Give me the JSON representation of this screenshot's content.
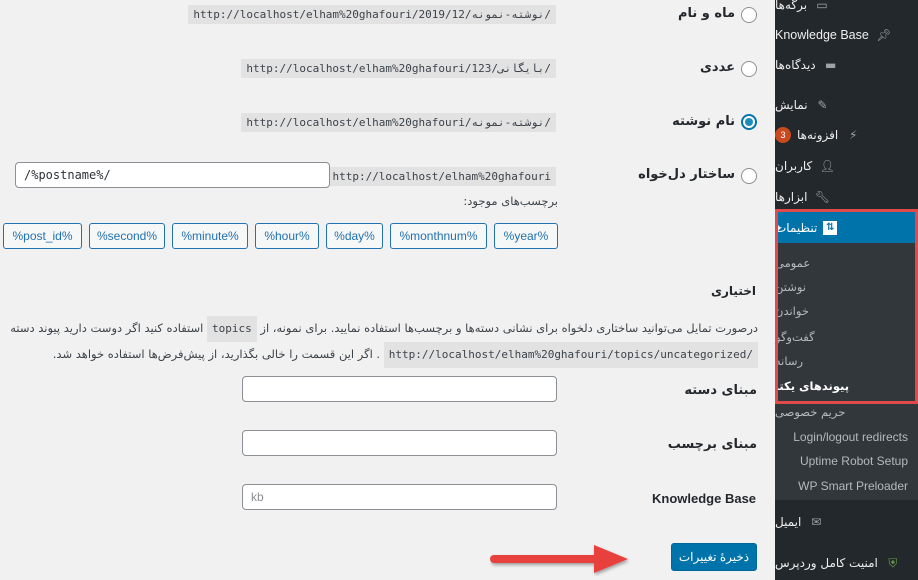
{
  "sidebar": {
    "items": [
      {
        "label": "برگه‌ها",
        "icon": "pages-icon"
      },
      {
        "label": "Knowledge Base",
        "icon": "pin-icon"
      },
      {
        "label": "دیدگاه‌ها",
        "icon": "comment-icon"
      },
      {
        "label": "نمایش",
        "icon": "brush-icon"
      },
      {
        "label": "افزونه‌ها",
        "icon": "plugin-icon",
        "badge": "3"
      },
      {
        "label": "کاربران",
        "icon": "user-icon"
      },
      {
        "label": "ابزارها",
        "icon": "wrench-icon"
      },
      {
        "label": "تنظیمات",
        "icon": "settings-icon"
      }
    ],
    "submenu": [
      "عمومی",
      "نوشتن",
      "خواندن",
      "گفت‌وگو",
      "رسانه",
      "پیوندهای یکتا",
      "حریم خصوصی",
      "Login/logout redirects",
      "Uptime Robot Setup",
      "WP Smart Preloader"
    ],
    "bottom_items": [
      {
        "label": "ایمیل",
        "icon": "mail-icon"
      },
      {
        "label": "امنیت کامل وردپرس",
        "icon": "shield-icon"
      }
    ]
  },
  "permalink_options": [
    {
      "label": "ماه و نام",
      "example": "http://localhost/elham%20ghafouri/2019/12/نوشته-نمونه/",
      "checked": false
    },
    {
      "label": "عددی",
      "example": "http://localhost/elham%20ghafouri/123/بایگانی/",
      "checked": false
    },
    {
      "label": "نام نوشته",
      "example": "http://localhost/elham%20ghafouri/نوشته-نمونه/",
      "checked": true
    },
    {
      "label": "ساختار دل‌خواه",
      "example": "http://localhost/elham%20ghafouri",
      "checked": false,
      "value": "/%postname%/"
    }
  ],
  "available_tags_label": "برچسب‌های موجود:",
  "tags": [
    "%year%",
    "%monthnum%",
    "%day%",
    "%hour%",
    "%minute%",
    "%second%",
    "%post_id%"
  ],
  "optional": {
    "title": "اختیاری",
    "desc_line1_a": "درصورت تمایل می‌توانید ساختاری دلخواه برای نشانی دسته‌ها و برچسب‌ها استفاده نمایید. برای نمونه، از",
    "desc_code1": "topics",
    "desc_line1_b": "استفاده کنید اگر دوست دارید پیوند دسته",
    "desc_code2": "http://localhost/elham%20ghafouri/topics/uncategorized/",
    "desc_line2_b": ". اگر این قسمت را خالی بگذارید، از پیش‌فرض‌ها استفاده خواهد شد."
  },
  "fields": [
    {
      "label": "مبنای دسته",
      "value": "",
      "placeholder": ""
    },
    {
      "label": "مبنای برچسب",
      "value": "",
      "placeholder": ""
    },
    {
      "label": "Knowledge Base",
      "value": "",
      "placeholder": "kb"
    }
  ],
  "save_label": "ذخیرهٔ تغییرات",
  "colors": {
    "accent": "#0073aa",
    "highlight": "#e04a4a",
    "badge": "#ca4a1f"
  }
}
